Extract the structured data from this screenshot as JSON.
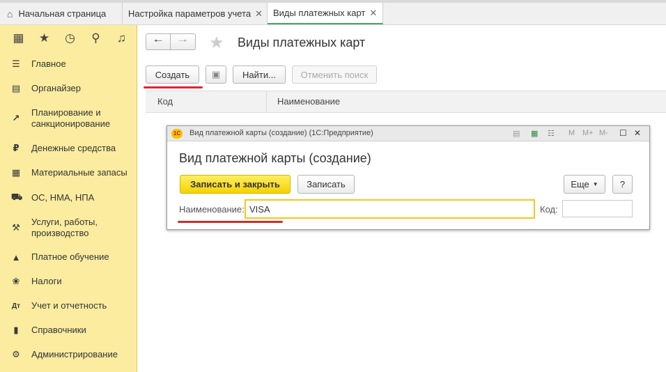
{
  "tabs": [
    {
      "label": "Начальная страница"
    },
    {
      "label": "Настройка параметров учета"
    },
    {
      "label": "Виды платежных карт"
    }
  ],
  "sidebar": {
    "items": [
      {
        "label": "Главное",
        "icon": "menu-lines-icon"
      },
      {
        "label": "Органайзер",
        "icon": "clipboard-icon"
      },
      {
        "label": "Планирование и санкционирование",
        "icon": "chart-icon"
      },
      {
        "label": "Денежные средства",
        "icon": "ruble-icon"
      },
      {
        "label": "Материальные запасы",
        "icon": "grid-icon"
      },
      {
        "label": "ОС, НМА, НПА",
        "icon": "truck-icon"
      },
      {
        "label": "Услуги, работы, производство",
        "icon": "tools-icon"
      },
      {
        "label": "Платное обучение",
        "icon": "graduation-cap-icon"
      },
      {
        "label": "Налоги",
        "icon": "eagle-icon"
      },
      {
        "label": "Учет и отчетность",
        "icon": "debit-credit-icon"
      },
      {
        "label": "Справочники",
        "icon": "book-icon"
      },
      {
        "label": "Администрирование",
        "icon": "gear-icon"
      }
    ]
  },
  "main": {
    "title": "Виды платежных карт",
    "toolbar": {
      "create_label": "Создать",
      "find_label": "Найти...",
      "cancel_search_label": "Отменить поиск"
    },
    "columns": [
      "Код",
      "Наименование"
    ]
  },
  "dialog": {
    "window_title": "Вид платежной карты (создание) (1С:Предприятие)",
    "heading": "Вид платежной карты (создание)",
    "save_close_label": "Записать и закрыть",
    "save_label": "Записать",
    "more_label": "Еще",
    "help_label": "?",
    "name_label": "Наименование:",
    "name_value": "VISA",
    "code_label": "Код:",
    "code_value": ""
  },
  "colors": {
    "sidebar_bg": "#fbec9f",
    "primary_button": "#f5d200",
    "highlight_underline": "#d62b2b",
    "active_tab_underline": "#4aa36a"
  }
}
